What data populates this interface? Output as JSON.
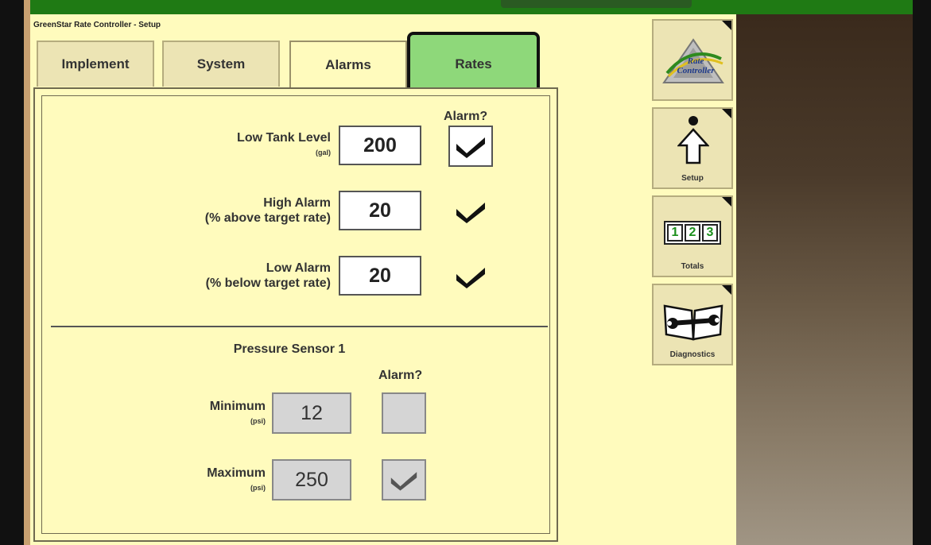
{
  "window": {
    "title": "GreenStar Rate Controller - Setup"
  },
  "tabs": [
    {
      "label": "Implement"
    },
    {
      "label": "System"
    },
    {
      "label": "Alarms"
    },
    {
      "label": "Rates"
    }
  ],
  "alarm_column_header": "Alarm?",
  "fields": {
    "low_tank": {
      "label": "Low Tank Level",
      "unit": "(gal)",
      "value": "200",
      "alarm": true
    },
    "high_alarm": {
      "label": "High Alarm",
      "sublabel": "(% above target rate)",
      "value": "20",
      "alarm": true
    },
    "low_alarm": {
      "label": "Low Alarm",
      "sublabel": "(% below target rate)",
      "value": "20",
      "alarm": true
    }
  },
  "pressure": {
    "title": "Pressure Sensor 1",
    "alarm_header": "Alarm?",
    "minimum": {
      "label": "Minimum",
      "unit": "(psi)",
      "value": "12",
      "alarm": false
    },
    "maximum": {
      "label": "Maximum",
      "unit": "(psi)",
      "value": "250",
      "alarm": true
    }
  },
  "side_buttons": {
    "rate_controller": {
      "logo_line1": "Rate",
      "logo_line2": "Controller"
    },
    "setup": {
      "label": "Setup"
    },
    "totals": {
      "label": "Totals",
      "digits": [
        "1",
        "2",
        "3"
      ]
    },
    "diagnostics": {
      "label": "Diagnostics"
    }
  },
  "colors": {
    "screen_bg": "#fffbbd",
    "active_tab_green": "#8ed87a",
    "top_bar_green": "#1f7a14",
    "digit_green": "#1a8f1a"
  }
}
